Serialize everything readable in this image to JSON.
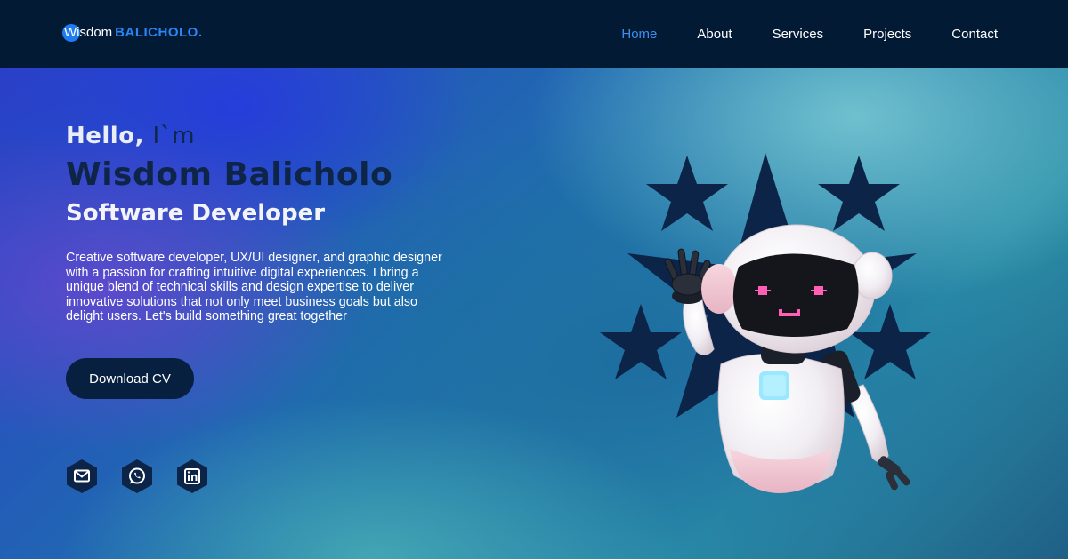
{
  "logo": {
    "first": "Wisdom",
    "last": "BALICHOLO."
  },
  "nav": {
    "items": [
      {
        "label": "Home",
        "active": true
      },
      {
        "label": "About",
        "active": false
      },
      {
        "label": "Services",
        "active": false
      },
      {
        "label": "Projects",
        "active": false
      },
      {
        "label": "Contact",
        "active": false
      }
    ]
  },
  "hero": {
    "greeting_hello": "Hello,",
    "greeting_im": "I`m",
    "name": "Wisdom Balicholo",
    "role": "Software Developer",
    "description": "Creative software developer, UX/UI designer, and graphic designer with a passion for crafting intuitive digital experiences. I bring a unique blend of technical skills and design expertise to deliver innovative solutions that not only meet business goals but also delight users. Let's build something great together",
    "cta_label": "Download CV"
  },
  "socials": [
    {
      "icon": "mail-icon"
    },
    {
      "icon": "whatsapp-icon"
    },
    {
      "icon": "linkedin-icon"
    }
  ],
  "colors": {
    "nav_background": "#031a35",
    "accent": "#2a86f5",
    "button_background": "#07203f",
    "star_color": "#0b2447"
  }
}
